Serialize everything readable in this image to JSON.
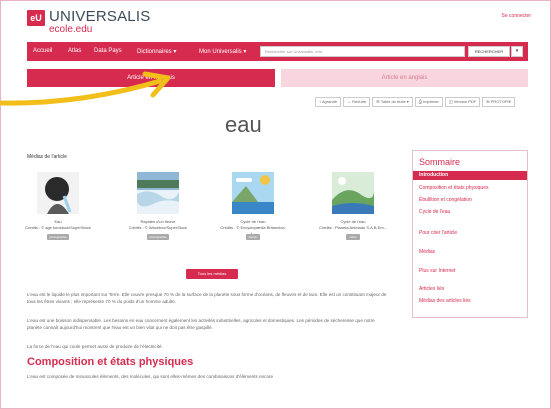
{
  "header": {
    "logo_text": "eU",
    "brand": "UNIVERSALIS",
    "brand_sub": "ecole.edu",
    "signin": "Se connecter"
  },
  "nav": {
    "items": [
      "Accueil",
      "Atlas",
      "Data Pays",
      "Dictionnaires ▾",
      "Mon Universalis ▾"
    ],
    "search_placeholder": "Rechercher sur Universalis .edu",
    "search_button": "RECHERCHER",
    "dropdown": "▾"
  },
  "tabs": {
    "french": "Article en français",
    "english": "Article en anglais"
  },
  "toolbar": [
    "↕ Agrandir",
    "↔ Réduire",
    "☰ Table du texte ▾",
    "⎙ Imprimer",
    "◫ Version PDF",
    "✉ PROTOPIE"
  ],
  "article": {
    "title": "eau",
    "media_label": "Médias de l'article",
    "media": [
      {
        "caption": "Eau",
        "credit": "Crédits : © age fotostock/SuperStock",
        "badge": "photographie"
      },
      {
        "caption": "Rapides d'un fleuve",
        "credit": "Crédits : © Wavebox/SuperStock",
        "badge": "photographie"
      },
      {
        "caption": "Cycle de l'eau",
        "credit": "Crédits : © Encyclopædia Britannica, I...",
        "badge": "dessin"
      },
      {
        "caption": "Cycle de l'eau",
        "credit": "Crédits : Planeta Animado S.A.B Em...",
        "badge": "vidéo"
      }
    ],
    "all_media": "Tous les médias",
    "paragraphs": [
      "L'eau est le liquide le plus important sur Terre. Elle couvre presque 70 % de la surface de la planète sous forme d'océans, de fleuves et de lacs. Elle est un constituant majeur de tous les êtres vivants ; elle représente 70 % du poids d'un homme adulte.",
      "L'eau est une boisson indispensable. Les besoins en eau concernent également les activités industrielles, agricoles et domestiques. Les périodes de sécheresse que notre planète connaît aujourd'hui montrent que l'eau est un bien vital qui ne doit pas être gaspillé.",
      "La force de l'eau qui coule permet aussi de produire de l'électricité."
    ],
    "section_title": "Composition et états physiques",
    "section_text": "L'eau est composée de minuscules éléments, des molécules, qui sont elles-mêmes des combinaisons d'éléments encore"
  },
  "sidebar": {
    "title": "Sommaire",
    "items": [
      "Introduction",
      "Composition et états physiques",
      "Ébullition et congélation",
      "Cycle de l'eau",
      "Pour citer l'article",
      "Médias",
      "Plus sur Internet",
      "Articles liés",
      "Médias des articles liés"
    ]
  },
  "colors": {
    "accent": "#d62b4f",
    "accent_light": "#f9d5df",
    "arrow": "#f2bf1a"
  }
}
